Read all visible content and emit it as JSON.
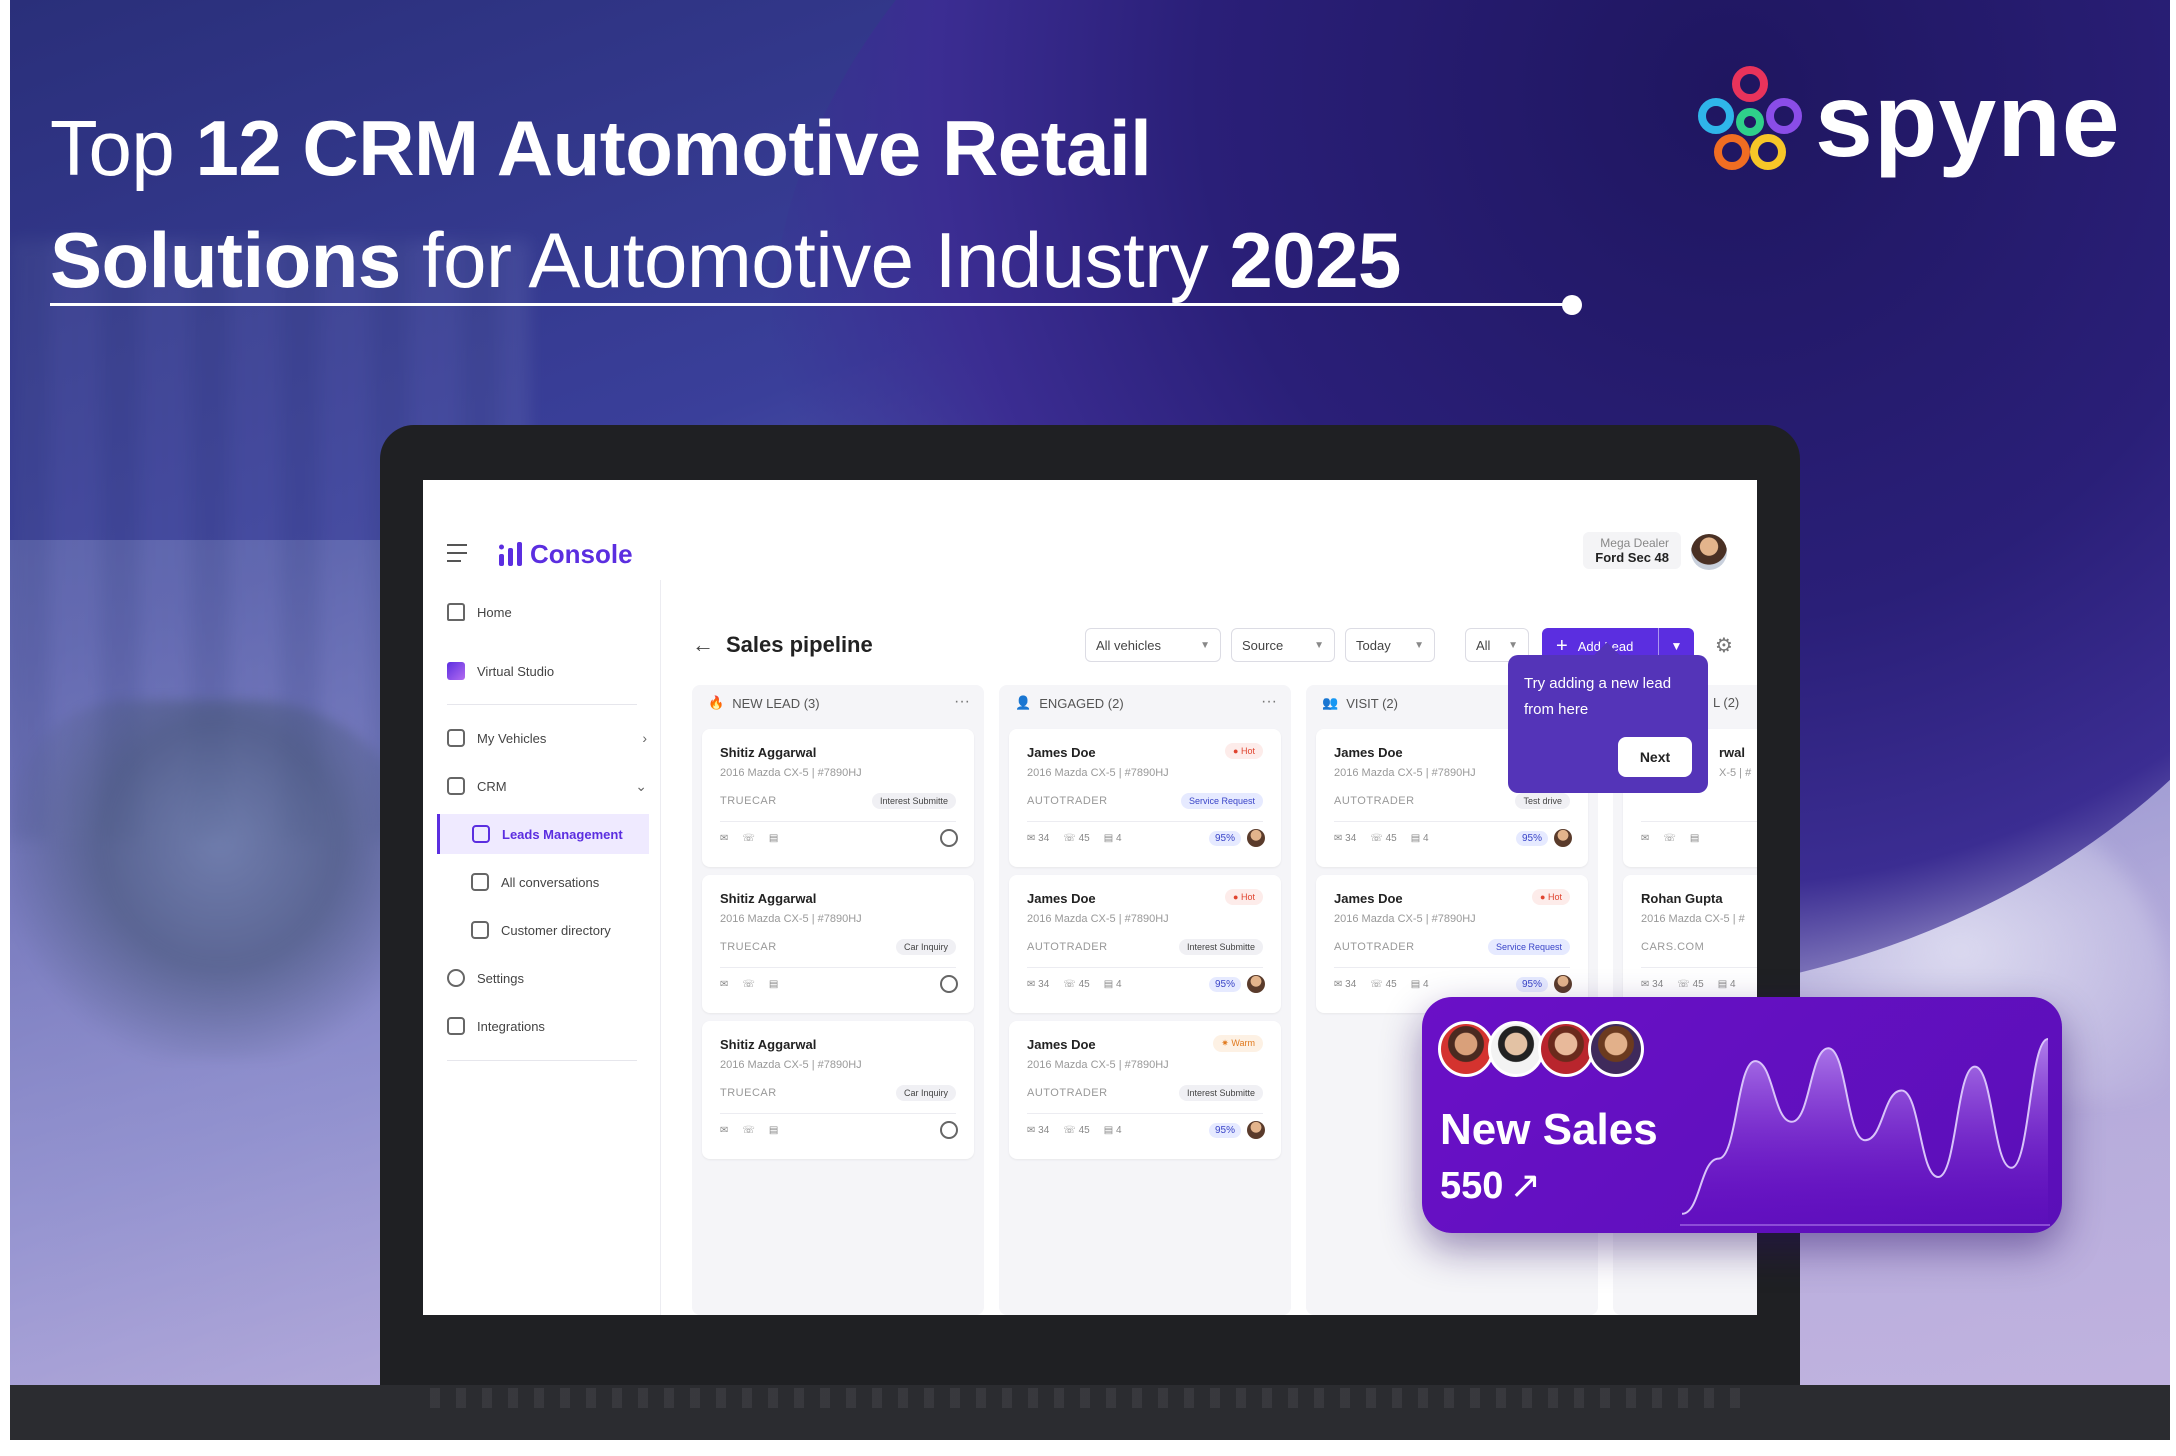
{
  "headline": {
    "line1_regular": "Top ",
    "line1_bold": "12 CRM Automotive Retail",
    "line2_bold": "Solutions",
    "line2_regular": " for Automotive Industry ",
    "line2_year": "2025"
  },
  "brand": {
    "name": "spyne"
  },
  "app": {
    "name": "Console",
    "dealer_label": "Mega Dealer",
    "dealer_name": "Ford Sec 48"
  },
  "sidebar": {
    "items": [
      {
        "label": "Home",
        "icon": "home-icon"
      },
      {
        "label": "Virtual Studio",
        "icon": "studio-icon"
      },
      {
        "label": "My Vehicles",
        "icon": "vehicles-icon"
      },
      {
        "label": "CRM",
        "icon": "crm-icon"
      },
      {
        "label": "Leads Management",
        "icon": "leads-icon"
      },
      {
        "label": "All conversations",
        "icon": "chat-icon"
      },
      {
        "label": "Customer directory",
        "icon": "directory-icon"
      },
      {
        "label": "Settings",
        "icon": "settings-icon"
      },
      {
        "label": "Integrations",
        "icon": "integrations-icon"
      }
    ]
  },
  "page": {
    "title": "Sales pipeline"
  },
  "filters": {
    "vehicles": "All vehicles",
    "source": "Source",
    "date": "Today",
    "all": "All",
    "add_lead": "Add Lead"
  },
  "tooltip": {
    "text": "Try adding a new lead from here",
    "button": "Next"
  },
  "columns": [
    {
      "title": "NEW LEAD (3)",
      "cards": [
        {
          "name": "Shitiz Aggarwal",
          "car": "2016 Mazda CX-5  |  #7890HJ",
          "source": "TRUECAR",
          "tag": "Interest Submitte"
        },
        {
          "name": "Shitiz Aggarwal",
          "car": "2016 Mazda CX-5  |  #7890HJ",
          "source": "TRUECAR",
          "tag": "Car Inquiry"
        },
        {
          "name": "Shitiz Aggarwal",
          "car": "2016 Mazda CX-5  |  #7890HJ",
          "source": "TRUECAR",
          "tag": "Car Inquiry"
        }
      ]
    },
    {
      "title": "ENGAGED (2)",
      "cards": [
        {
          "name": "James Doe",
          "car": "2016 Mazda CX-5  |  #7890HJ",
          "source": "AUTOTRADER",
          "tag": "Service Request",
          "badge": "Hot",
          "m1": "34",
          "m2": "45",
          "m3": "4",
          "pct": "95%"
        },
        {
          "name": "James Doe",
          "car": "2016 Mazda CX-5  |  #7890HJ",
          "source": "AUTOTRADER",
          "tag": "Interest Submitte",
          "badge": "Hot",
          "m1": "34",
          "m2": "45",
          "m3": "4",
          "pct": "95%"
        },
        {
          "name": "James Doe",
          "car": "2016 Mazda CX-5  |  #7890HJ",
          "source": "AUTOTRADER",
          "tag": "Interest Submitte",
          "badge": "Warm",
          "m1": "34",
          "m2": "45",
          "m3": "4",
          "pct": "95%"
        }
      ]
    },
    {
      "title": "VISIT (2)",
      "cards": [
        {
          "name": "James Doe",
          "car": "2016 Mazda CX-5  |  #7890HJ",
          "source": "AUTOTRADER",
          "tag": "Test drive",
          "m1": "34",
          "m2": "45",
          "m3": "4",
          "pct": "95%"
        },
        {
          "name": "James Doe",
          "car": "2016 Mazda CX-5  |  #7890HJ",
          "source": "AUTOTRADER",
          "tag": "Service Request",
          "badge": "Hot",
          "m1": "34",
          "m2": "45",
          "m3": "4",
          "pct": "95%"
        }
      ]
    },
    {
      "title": "L (2)",
      "cards": [
        {
          "name": "rwal",
          "car": "X-5  |  #",
          "source": ""
        },
        {
          "name": "Rohan Gupta",
          "car": "2016 Mazda CX-5  |  #",
          "source": "CARS.COM",
          "m1": "34",
          "m2": "45",
          "m3": "4"
        }
      ]
    }
  ],
  "sales_card": {
    "title": "New Sales",
    "value": "550",
    "trend_symbol": "↗",
    "sparkline": [
      0.05,
      0.35,
      0.88,
      0.55,
      0.95,
      0.45,
      0.72,
      0.25,
      0.85,
      0.3,
      1.0
    ]
  },
  "colors": {
    "accent": "#5b2ee0",
    "sales_card": "#6a10c7",
    "hot": "#e0442f",
    "warm": "#e07a1f"
  }
}
